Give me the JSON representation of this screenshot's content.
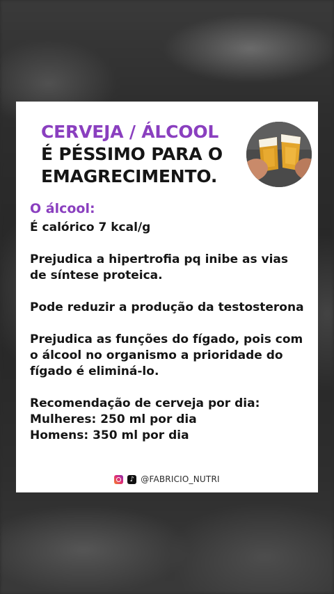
{
  "header": {
    "line1": "CERVEJA / ÁLCOOL",
    "line2": "É PÉSSIMO PARA O",
    "line3": "EMAGRECIMENTO."
  },
  "content": {
    "subtitle": "O álcool:",
    "items": [
      "É calórico 7 kcal/g",
      "Prejudica a hipertrofia pq inibe as vias de síntese proteica.",
      "Pode reduzir a produção da testosterona",
      "Prejudica as funções do fígado, pois com o álcool no organismo a prioridade do fígado é eliminá-lo."
    ],
    "recommendation": {
      "title": "Recomendação de cerveja por dia:",
      "women": "Mulheres: 250 ml por dia",
      "men": "Homens: 350 ml por dia"
    }
  },
  "footer": {
    "handle": "@FABRICIO_NUTRI",
    "icons": [
      "instagram-icon",
      "tiktok-icon"
    ]
  },
  "colors": {
    "accent": "#8a3fbf",
    "text": "#151515",
    "card": "#ffffff"
  }
}
